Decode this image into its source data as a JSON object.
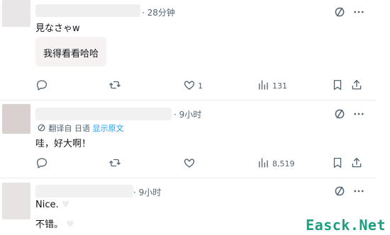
{
  "posts": [
    {
      "time": "· 28分钟",
      "text": "見なさゃw",
      "quote_text": "我得看看哈哈",
      "actions": {
        "likes": "1",
        "views": "131"
      }
    },
    {
      "time": "· 9小时",
      "translate_label": "翻译自 日语",
      "show_original": "显示原文",
      "text": "哇，好大啊！",
      "actions": {
        "views": "8,519"
      }
    },
    {
      "time": "· 9小时",
      "lines": [
        "Nice.",
        "不错。"
      ]
    }
  ],
  "watermark": "Easck.Net",
  "colors": {
    "link": "#1d9bf0",
    "meta": "#536471",
    "watermark": "#1aa080"
  }
}
